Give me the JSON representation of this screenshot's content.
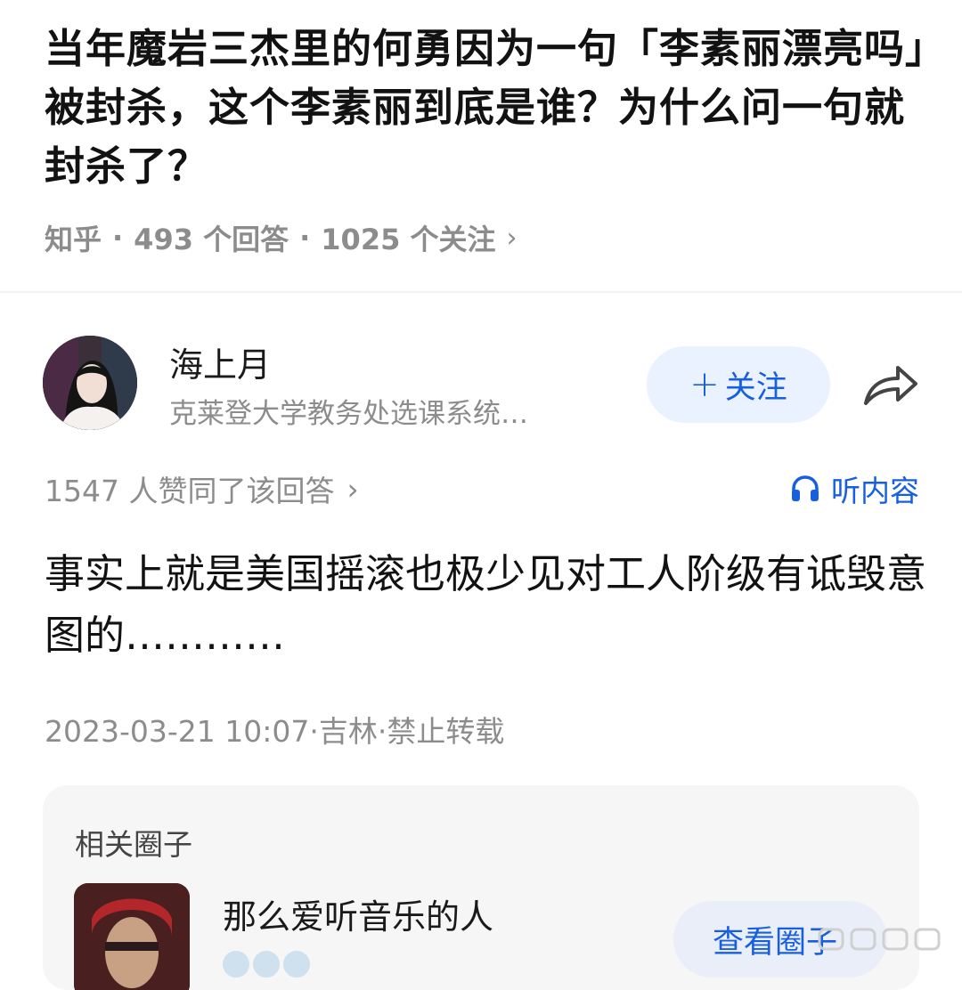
{
  "question": {
    "title": "当年魔岩三杰里的何勇因为一句「李素丽漂亮吗」被封杀，这个李素丽到底是谁？为什么问一句就封杀了？",
    "source": "知乎",
    "sep": "·",
    "answers": "493 个回答",
    "followers": "1025 个关注",
    "chevron": "›"
  },
  "author": {
    "name": "海上月",
    "bio": "克莱登大学教务处选课系统…",
    "avatar_icon": "avatar-photo",
    "follow_label": "关注",
    "follow_plus": "+",
    "share_icon": "share-arrow-icon"
  },
  "answer": {
    "votes": "1547 人赞同了该回答",
    "votes_chevron": "›",
    "listen_label": "听内容",
    "listen_icon": "headphones-icon",
    "text": "事实上就是美国摇滚也极少见对工人阶级有诋毁意图的…………",
    "meta": "2023-03-21 10:07·吉林·禁止转载"
  },
  "circle": {
    "section_title": "相关圈子",
    "name": "那么爱听音乐的人",
    "button_label": "查看圈子"
  },
  "colors": {
    "accent": "#175fe0",
    "accent_bg": "#eaf1ff",
    "muted": "#8c8c8c",
    "card_bg": "#f6f6f6"
  }
}
